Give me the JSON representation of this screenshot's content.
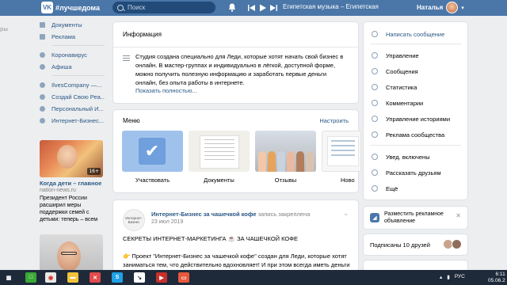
{
  "header": {
    "logo_mark": "VK",
    "community": "#лучшедома",
    "search_placeholder": "Поиск",
    "track": "Египетская музыка – Египетская",
    "user_name": "Наталья",
    "prev_icon": "previous-icon",
    "play_icon": "play-icon",
    "next_icon": "next-icon"
  },
  "left_edge_text": "ры",
  "sidebar": {
    "items": [
      {
        "label": "Документы"
      },
      {
        "label": "Реклама"
      },
      {
        "label": "Коронавирус"
      },
      {
        "label": "Афиша"
      },
      {
        "label": "IlvesCompany —..."
      },
      {
        "label": "Создай Свою Реа..."
      },
      {
        "label": "Персональный И..."
      },
      {
        "label": "Интернет-Бизнес..."
      }
    ]
  },
  "ad": {
    "badge": "16+",
    "title": "Когда дети – главное",
    "source": "nation-news.ru",
    "description": "Президент России расширил меры поддержки семей с детьми: теперь – всем"
  },
  "info": {
    "title": "Информация",
    "text": "Студия создана специально для Леди, которые хотят начать свой бизнес в онлайн. В мастер-группах и индивидуально в лёгкой, доступной форме, можно получить полезную информацию и заработать первые деньги онлайн, без опыта работы в интернете.",
    "more": "Показать полностью..."
  },
  "menu": {
    "title": "Меню",
    "configure": "Настроить",
    "tiles": [
      {
        "label": "Участвовать"
      },
      {
        "label": "Документы"
      },
      {
        "label": "Отзывы"
      },
      {
        "label": "Ново"
      }
    ]
  },
  "post": {
    "avatar_text": "Интернет-Бизнес",
    "author": "Интернет-Бизнес за чашечкой кофе",
    "pinned": "запись закреплена",
    "date": "23 июл 2019",
    "headline": "СЕКРЕТЫ ИНТЕРНЕТ-МАРКЕТИНГА ☕ ЗА ЧАШЕЧКОЙ КОФЕ",
    "body": "👉 Проект \"Интернет-Бизнес за чашечкой кофе\" создан для Леди, которые хотят заниматься тем, что действительно вдохновляет! И при этом всегда иметь деньги"
  },
  "right_menu": {
    "items": [
      {
        "label": "Написать сообщение",
        "accent": true
      },
      {
        "label": "Управление"
      },
      {
        "label": "Сообщения"
      },
      {
        "label": "Статистика"
      },
      {
        "label": "Комментарии"
      },
      {
        "label": "Управление историями"
      },
      {
        "label": "Реклама сообщества"
      },
      {
        "label": "Увед. включены"
      },
      {
        "label": "Рассказать друзьям"
      },
      {
        "label": "Ещё"
      }
    ]
  },
  "promo": {
    "text": "Разместить рекламное объявление"
  },
  "subscribers": {
    "text": "Подписаны 10 друзей"
  },
  "taskbar": {
    "lang": "РУС",
    "time": "6:11",
    "date": "05.06.2"
  },
  "colors": {
    "brand": "#4a76a8",
    "link": "#2a5885",
    "background": "#edeef0"
  }
}
